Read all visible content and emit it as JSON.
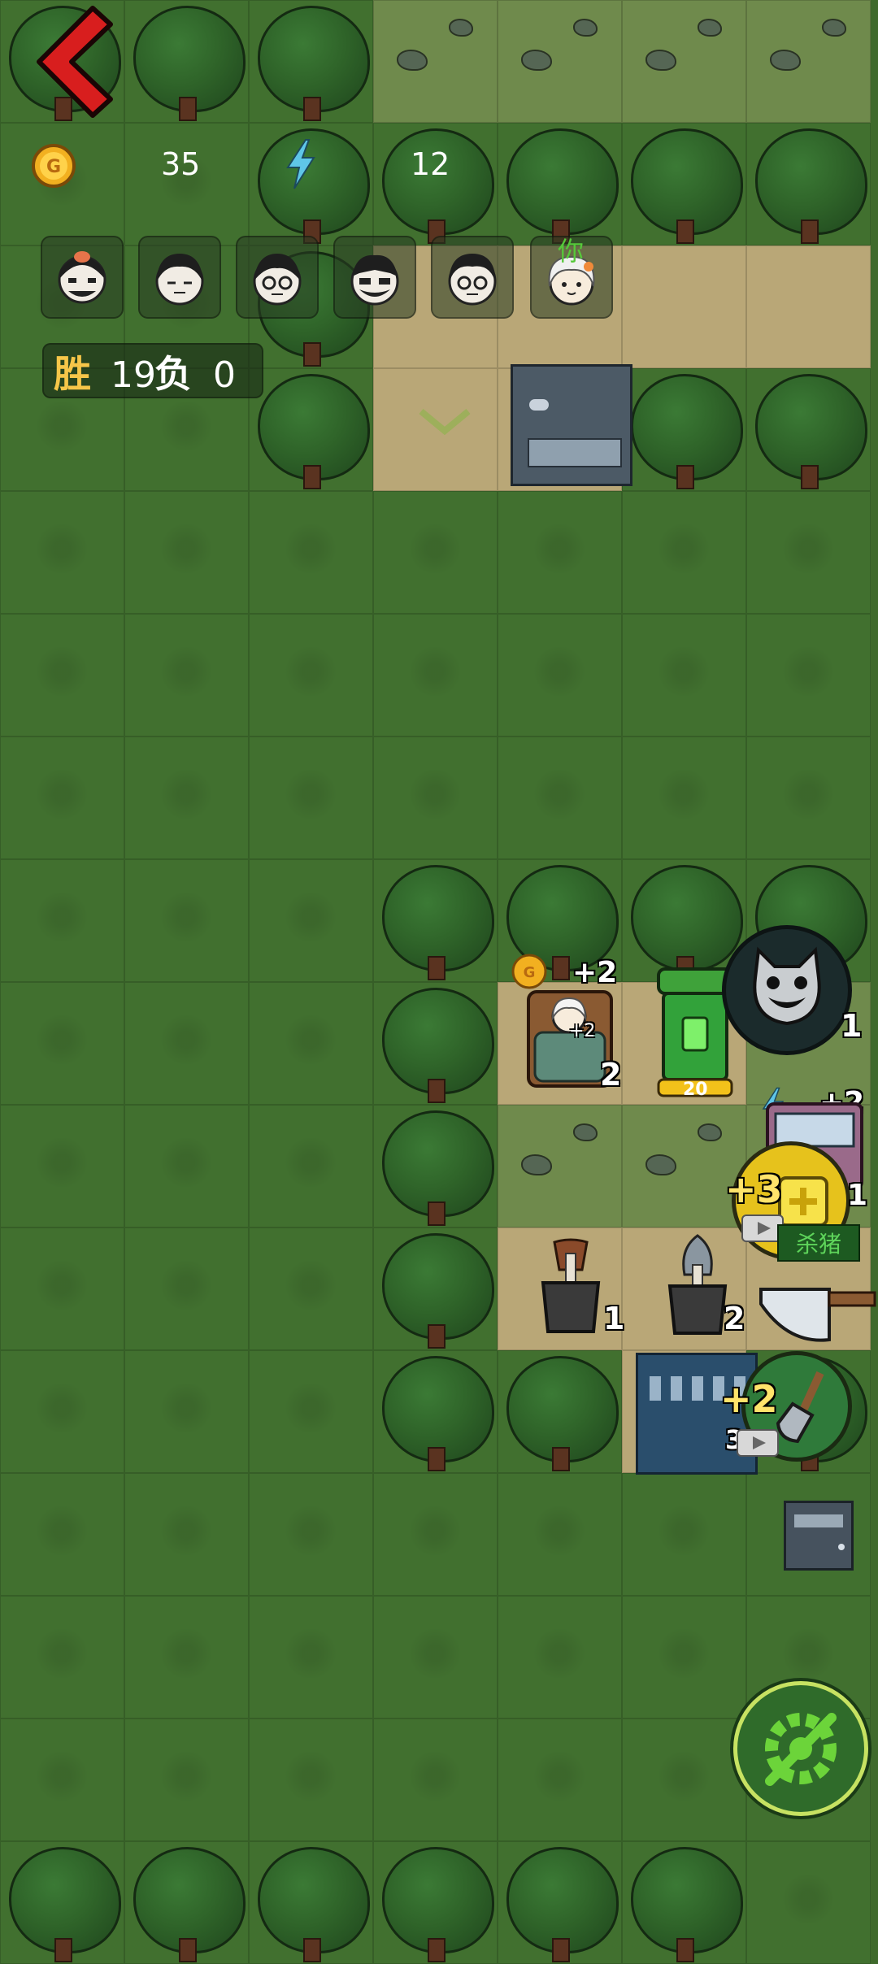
{
  "hud": {
    "gold": "35",
    "energy": "12",
    "coin_icon": "gold-coin-icon",
    "energy_icon": "lightning-bolt-icon",
    "back_icon": "red-chevron-left-icon"
  },
  "players": [
    {
      "icon": "player-avatar-1"
    },
    {
      "icon": "player-avatar-2"
    },
    {
      "icon": "player-avatar-3"
    },
    {
      "icon": "player-avatar-4"
    },
    {
      "icon": "player-avatar-5"
    },
    {
      "icon": "player-avatar-you",
      "tag": "你"
    }
  ],
  "score": {
    "win_label": "胜",
    "wins": "19",
    "lose_label": "负",
    "losses": "0"
  },
  "board": {
    "bed": {
      "coin_bonus": "+2",
      "inner_bonus": "+2",
      "count": "2"
    },
    "trash_can": {
      "count": "20"
    },
    "monster": {
      "count": "1"
    },
    "energy_bonus": "+2",
    "bonus_badge": {
      "plus": "+3",
      "count": "1"
    },
    "pig_label": "杀猪",
    "buckets": [
      {
        "count": "1"
      },
      {
        "count": "2"
      }
    ],
    "shovel": {
      "plus": "+2",
      "count": "3"
    }
  },
  "colors": {
    "grass": "#41702f",
    "tree": "#2f6429",
    "dirt": "#b9a777",
    "gold_accent": "#f6c649",
    "back_red": "#d81e1e",
    "settings_green": "#6cd43a"
  }
}
